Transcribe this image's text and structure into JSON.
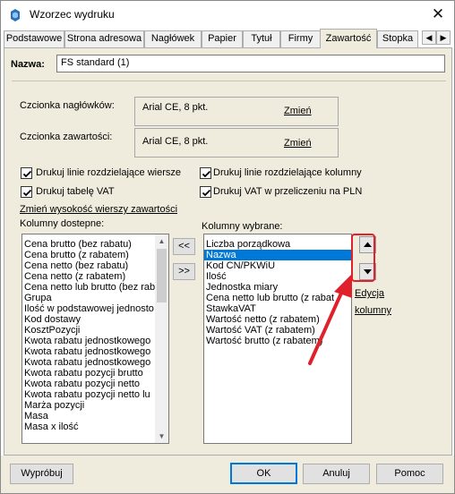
{
  "window": {
    "title": "Wzorzec wydruku"
  },
  "tabs": [
    {
      "label": "Podstawowe"
    },
    {
      "label": "Strona adresowa"
    },
    {
      "label": "Nagłówek"
    },
    {
      "label": "Papier"
    },
    {
      "label": "Tytuł"
    },
    {
      "label": "Firmy"
    },
    {
      "label": "Zawartość",
      "active": true
    },
    {
      "label": "Stopka"
    }
  ],
  "tab_scroll": {
    "left": "◀",
    "right": "▶"
  },
  "name_field": {
    "label": "Nazwa:",
    "value": "FS standard (1)"
  },
  "fonts": {
    "header_label": "Czcionka nagłówków:",
    "header_value": "Arial CE, 8 pkt.",
    "header_change": "Zmień",
    "content_label": "Czcionka zawartości:",
    "content_value": "Arial CE, 8 pkt.",
    "content_change": "Zmień"
  },
  "checkboxes": {
    "row_lines": {
      "label": "Drukuj linie rozdzielające wiersze",
      "checked": true
    },
    "col_lines": {
      "label": "Drukuj linie rozdzielające kolumny",
      "checked": true
    },
    "vat_table": {
      "label": "Drukuj tabelę VAT",
      "checked": true
    },
    "vat_pln": {
      "label": "Drukuj VAT w przeliczeniu na PLN",
      "checked": true
    }
  },
  "row_height_link": "Zmień wysokość wierszy zawartości",
  "available": {
    "label": "Kolumny dostepne:",
    "items": [
      "Cena brutto (bez rabatu)",
      "Cena brutto (z rabatem)",
      "Cena netto (bez rabatu)",
      "Cena netto (z rabatem)",
      "Cena netto lub brutto (bez rab",
      "Grupa",
      "Ilość w podstawowej jednosto",
      "Kod dostawy",
      "KosztPozycji",
      "Kwota rabatu jednostkowego",
      "Kwota rabatu jednostkowego",
      "Kwota rabatu jednostkowego",
      "Kwota rabatu pozycji brutto",
      "Kwota rabatu pozycji netto",
      "Kwota rabatu pozycji netto lu",
      "Marża pozycji",
      "Masa",
      "Masa x ilość"
    ]
  },
  "transfer": {
    "add": "<<",
    "remove": ">>"
  },
  "selected": {
    "label": "Kolumny wybrane:",
    "items": [
      "Liczba porządkowa",
      "Nazwa",
      "Kod CN/PKWiU",
      "Ilość",
      "Jednostka miary",
      "Cena netto lub brutto (z rabat",
      "StawkaVAT",
      "Wartość netto (z rabatem)",
      "Wartość VAT (z rabatem)",
      "Wartość brutto (z rabatem)"
    ],
    "selected_index": 1
  },
  "edit_columns": {
    "line1": "Edycja",
    "line2": "kolumny"
  },
  "buttons": {
    "preview": "Wypróbuj",
    "ok": "OK",
    "cancel": "Anuluj",
    "help": "Pomoc"
  },
  "colors": {
    "panel_bg": "#f0ecdd",
    "selection": "#0078d7",
    "annotation": "#e0202a",
    "default_button_border": "#0078d7"
  }
}
